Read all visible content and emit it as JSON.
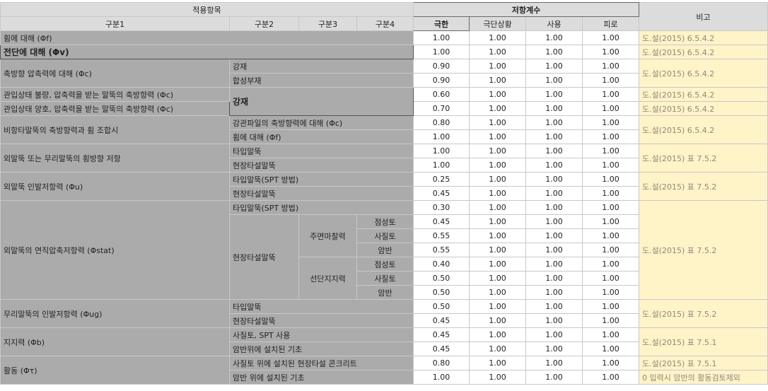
{
  "header": {
    "apply_items": "적용항목",
    "resistance_factors": "저항계수",
    "remarks": "비고",
    "cat1": "구분1",
    "cat2": "구분2",
    "cat3": "구분3",
    "cat4": "구분4",
    "limit": "극한",
    "extreme": "극단상황",
    "service": "사용",
    "fatigue": "피로"
  },
  "cat1": {
    "r1": "휨에 대해 (Φf)",
    "r2": "전단에 대해 (Φv)",
    "r3": "축방향 압축력에 대해 (Φc)",
    "r5": "관입상태 불량, 압축력을 받는 말뚝의 축방향력 (Φc)",
    "r6": "관입상태 양호, 압축력을 받는 말뚝의 축방향력 (Φc)",
    "r7": "비항타말뚝의 축방향력과 휨 조합시",
    "r9": "외말뚝 또는 무리말뚝의 횡방향 저항",
    "r11": "외말뚝 인발저항력 (Φu)",
    "r13": "외말뚝의 연직압축저항력 (Φstat)",
    "r20": "무리말뚝의 인발저항력 (Φug)",
    "r22": "지지력 (Φb)",
    "r24": "활동 (Φτ)"
  },
  "cat2": {
    "r3": "강재",
    "r4": "합성부재",
    "r5": "강재",
    "r7": "강관파일의 축방향력에 대해 (Φc)",
    "r8": "휨에 대해 (Φf)",
    "r9": "타입말뚝",
    "r10": "현장타설말뚝",
    "r11": "타입말뚝(SPT 방법)",
    "r12": "현장타설말뚝",
    "r13": "타입말뚝(SPT 방법)",
    "r14": "현장타설말뚝",
    "r20": "타입말뚝",
    "r21": "현장타설말뚝",
    "r22": "사질토, SPT 사용",
    "r23": "암반위에 설치된 기초",
    "r24": "사질토 위에 설치된 현장타설 콘크리트",
    "r25": "암반 위에 설치된 기초"
  },
  "cat3": {
    "r14": "주면마찰력",
    "r17": "선단지지력"
  },
  "cat4": {
    "r14": "점성토",
    "r15": "사질토",
    "r16": "암반",
    "r17": "점성토",
    "r18": "사질토",
    "r19": "암반"
  },
  "values": {
    "r1": [
      "1.00",
      "1.00",
      "1.00",
      "1.00"
    ],
    "r2": [
      "1.00",
      "1.00",
      "1.00",
      "1.00"
    ],
    "r3": [
      "0.90",
      "1.00",
      "1.00",
      "1.00"
    ],
    "r4": [
      "0.90",
      "1.00",
      "1.00",
      "1.00"
    ],
    "r5": [
      "0.60",
      "1.00",
      "1.00",
      "1.00"
    ],
    "r6": [
      "0.70",
      "1.00",
      "1.00",
      "1.00"
    ],
    "r7": [
      "0.80",
      "1.00",
      "1.00",
      "1.00"
    ],
    "r8": [
      "1.00",
      "1.00",
      "1.00",
      "1.00"
    ],
    "r9": [
      "1.00",
      "1.00",
      "1.00",
      "1.00"
    ],
    "r10": [
      "1.00",
      "1.00",
      "1.00",
      "1.00"
    ],
    "r11": [
      "0.25",
      "1.00",
      "1.00",
      "1.00"
    ],
    "r12": [
      "0.45",
      "1.00",
      "1.00",
      "1.00"
    ],
    "r13": [
      "0.30",
      "1.00",
      "1.00",
      "1.00"
    ],
    "r14": [
      "0.45",
      "1.00",
      "1.00",
      "1.00"
    ],
    "r15": [
      "0.55",
      "1.00",
      "1.00",
      "1.00"
    ],
    "r16": [
      "0.55",
      "1.00",
      "1.00",
      "1.00"
    ],
    "r17": [
      "0.40",
      "1.00",
      "1.00",
      "1.00"
    ],
    "r18": [
      "0.50",
      "1.00",
      "1.00",
      "1.00"
    ],
    "r19": [
      "0.50",
      "1.00",
      "1.00",
      "1.00"
    ],
    "r20": [
      "0.50",
      "1.00",
      "1.00",
      "1.00"
    ],
    "r21": [
      "0.45",
      "1.00",
      "1.00",
      "1.00"
    ],
    "r22": [
      "0.45",
      "1.00",
      "1.00",
      "1.00"
    ],
    "r23": [
      "0.45",
      "1.00",
      "1.00",
      "1.00"
    ],
    "r24": [
      "0.80",
      "1.00",
      "1.00",
      "1.00"
    ],
    "r25": [
      "1.00",
      "1.00",
      "1.00",
      "1.00"
    ]
  },
  "remarks": {
    "r1": "도.설(2015) 6.5.4.2",
    "r2": "도.설(2015) 6.5.4.2",
    "r3": "도.설(2015) 6.5.4.2",
    "r5": "도.설(2015) 6.5.4.2",
    "r6": "도.설(2015) 6.5.4.2",
    "r7": "도.설(2015) 6.5.4.2",
    "r9": "도.설(2015) 표 7.5.2",
    "r11": "도.설(2015) 표 7.5.2",
    "r13": "도.설(2015) 표 7.5.2",
    "r20": "도.설(2015) 표 7.5.2",
    "r22": "도.설(2015) 표 7.5.1",
    "r24": "도.설(2015) 표 7.5.1",
    "r25": "0 입력시 암반의 활동검토제외"
  }
}
